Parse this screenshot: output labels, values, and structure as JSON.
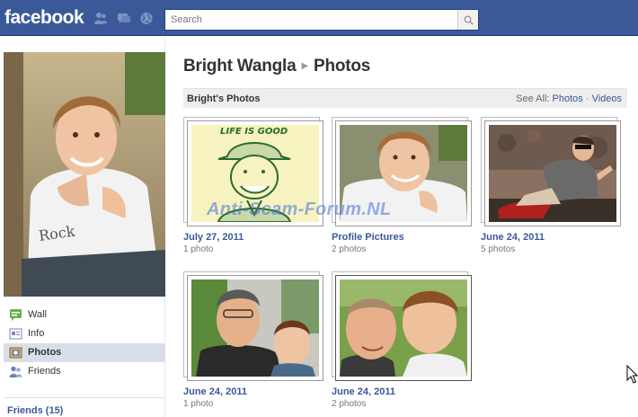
{
  "header": {
    "logo": "facebook",
    "search_placeholder": "Search"
  },
  "profile": {
    "name": "Bright Wangla",
    "section": "Photos"
  },
  "nav": {
    "items": [
      {
        "label": "Wall",
        "icon": "wall-icon"
      },
      {
        "label": "Info",
        "icon": "info-icon"
      },
      {
        "label": "Photos",
        "icon": "photos-icon",
        "active": true
      },
      {
        "label": "Friends",
        "icon": "friends-icon"
      }
    ],
    "friends_label": "Friends (15)"
  },
  "photos_section": {
    "title": "Bright's Photos",
    "see_all_prefix": "See All:",
    "see_all_photos": "Photos",
    "separator": "·",
    "see_all_videos": "Videos"
  },
  "albums": [
    {
      "name": "July 27, 2011",
      "count": "1 photo"
    },
    {
      "name": "Profile Pictures",
      "count": "2 photos"
    },
    {
      "name": "June 24, 2011",
      "count": "5 photos"
    },
    {
      "name": "June 24, 2011",
      "count": "1 photo"
    },
    {
      "name": "June 24, 2011",
      "count": "2 photos"
    }
  ],
  "watermark": "Anti-Scam-Forum.NL",
  "colors": {
    "brand_blue": "#3b5998",
    "link_blue": "#3b5998",
    "nav_active_bg": "#d8dfea",
    "header_bg": "#eeeeee"
  }
}
